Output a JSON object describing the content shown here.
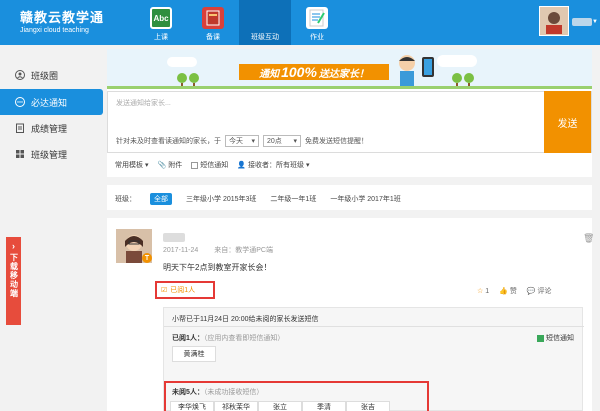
{
  "header": {
    "logo_cn": "赣教云教学通",
    "logo_en": "Jiangxi cloud teaching",
    "nav": [
      {
        "label": "上课",
        "icon": "abc-board-icon",
        "icon_text": "Abc"
      },
      {
        "label": "备课",
        "icon": "book-icon"
      },
      {
        "label": "班级互动",
        "icon": "class-interaction-icon",
        "active": true
      },
      {
        "label": "作业",
        "icon": "homework-icon"
      }
    ],
    "colors": {
      "primary": "#1a8fdd",
      "accent": "#f29100",
      "highlight": "#e53935"
    }
  },
  "sidebar": {
    "items": [
      {
        "label": "班级圈",
        "icon": "person-icon"
      },
      {
        "label": "必达通知",
        "icon": "chat-bubble-icon",
        "active": true
      },
      {
        "label": "成绩管理",
        "icon": "clipboard-icon"
      },
      {
        "label": "班级管理",
        "icon": "grid-icon"
      }
    ],
    "download_tab": "下载移动端"
  },
  "banner": {
    "prefix": "通知",
    "highlight": "100%",
    "suffix": "送达家长！"
  },
  "compose": {
    "placeholder": "发送通知给家长...",
    "remind_prefix": "针对未及时查看读通知的家长，于",
    "day_option": "今天",
    "hour_option": "20点",
    "remind_suffix": "免费发送短信提醒！",
    "send_label": "发送"
  },
  "toolbar": {
    "template": "常用模板",
    "attach": "附件",
    "sms": "短信通知",
    "receiver": "接收者：所有班级"
  },
  "class_filter": {
    "label": "班级：",
    "options": [
      "全部",
      "三年级小学 2015年3班",
      "二年级一年1班",
      "一年级小学 2017年1班"
    ]
  },
  "post": {
    "date": "2017-11-24",
    "source": "来自：教学通PC端",
    "content": "明天下午2点到教室开家长会！",
    "read_link": "已阅1人",
    "likes_star": "1",
    "like_label": "赞",
    "comment_label": "评论",
    "remind_text": "小帮已于11月24日 20:00给未阅的家长发送短信",
    "read_title": "已阅1人：",
    "read_note": "（应用内查看即短信通知）",
    "sms_flag": "短信通知",
    "read_names": [
      "黄满桂"
    ],
    "unread_title": "未阅5人：",
    "unread_note": "（未成功接收短信）",
    "unread_names": [
      "李华焕飞",
      "祁秋茉华",
      "张立",
      "季清",
      "张吉"
    ]
  }
}
